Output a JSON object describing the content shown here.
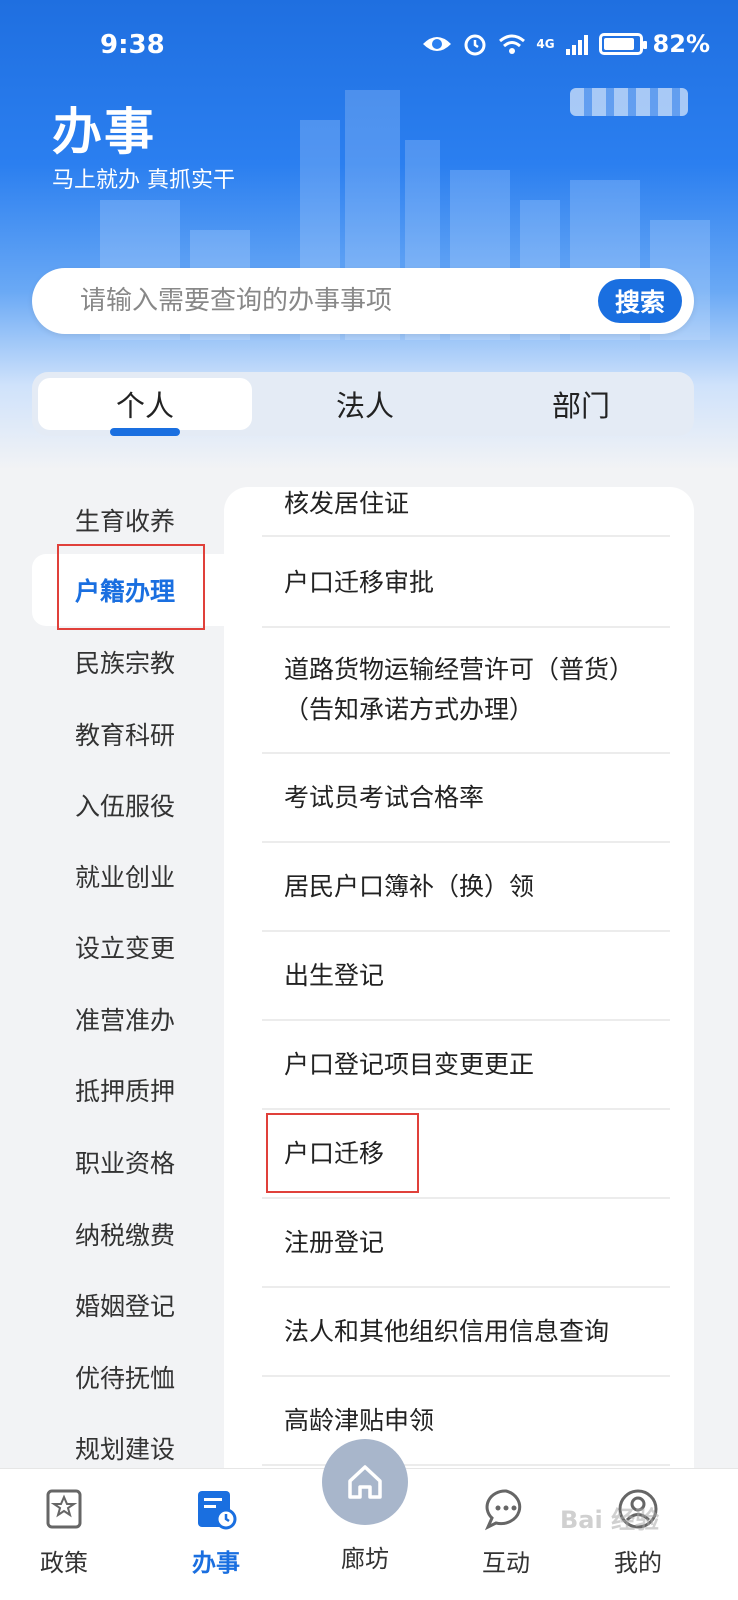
{
  "status_bar": {
    "time": "9:38",
    "battery": "82%",
    "network": "4G"
  },
  "header": {
    "title": "办事",
    "slogan": "马上就办 真抓实干"
  },
  "search": {
    "placeholder": "请输入需要查询的办事事项",
    "button_label": "搜索"
  },
  "tabs": [
    {
      "label": "个人",
      "active": true
    },
    {
      "label": "法人",
      "active": false
    },
    {
      "label": "部门",
      "active": false
    }
  ],
  "categories": [
    {
      "label": "生育收养",
      "active": false
    },
    {
      "label": "户籍办理",
      "active": true
    },
    {
      "label": "民族宗教",
      "active": false
    },
    {
      "label": "教育科研",
      "active": false
    },
    {
      "label": "入伍服役",
      "active": false
    },
    {
      "label": "就业创业",
      "active": false
    },
    {
      "label": "设立变更",
      "active": false
    },
    {
      "label": "准营准办",
      "active": false
    },
    {
      "label": "抵押质押",
      "active": false
    },
    {
      "label": "职业资格",
      "active": false
    },
    {
      "label": "纳税缴费",
      "active": false
    },
    {
      "label": "婚姻登记",
      "active": false
    },
    {
      "label": "优待抚恤",
      "active": false
    },
    {
      "label": "规划建设",
      "active": false
    }
  ],
  "items": [
    {
      "label": "核发居住证"
    },
    {
      "label": "户口迁移审批"
    },
    {
      "label": "道路货物运输经营许可（普货）（告知承诺方式办理）"
    },
    {
      "label": "考试员考试合格率"
    },
    {
      "label": "居民户口簿补（换）领"
    },
    {
      "label": "出生登记"
    },
    {
      "label": "户口登记项目变更更正"
    },
    {
      "label": "户口迁移"
    },
    {
      "label": "注册登记"
    },
    {
      "label": "法人和其他组织信用信息查询"
    },
    {
      "label": "高龄津贴申领"
    }
  ],
  "bottom_nav": [
    {
      "label": "政策",
      "icon": "policy-icon",
      "active": false
    },
    {
      "label": "办事",
      "icon": "affairs-icon",
      "active": true
    },
    {
      "label": "廊坊",
      "icon": "home-icon",
      "active": false
    },
    {
      "label": "互动",
      "icon": "chat-icon",
      "active": false
    },
    {
      "label": "我的",
      "icon": "user-icon",
      "active": false
    }
  ],
  "watermark": "Bai 经验",
  "colors": {
    "primary": "#1a6fe0",
    "highlight": "#e0403a"
  }
}
